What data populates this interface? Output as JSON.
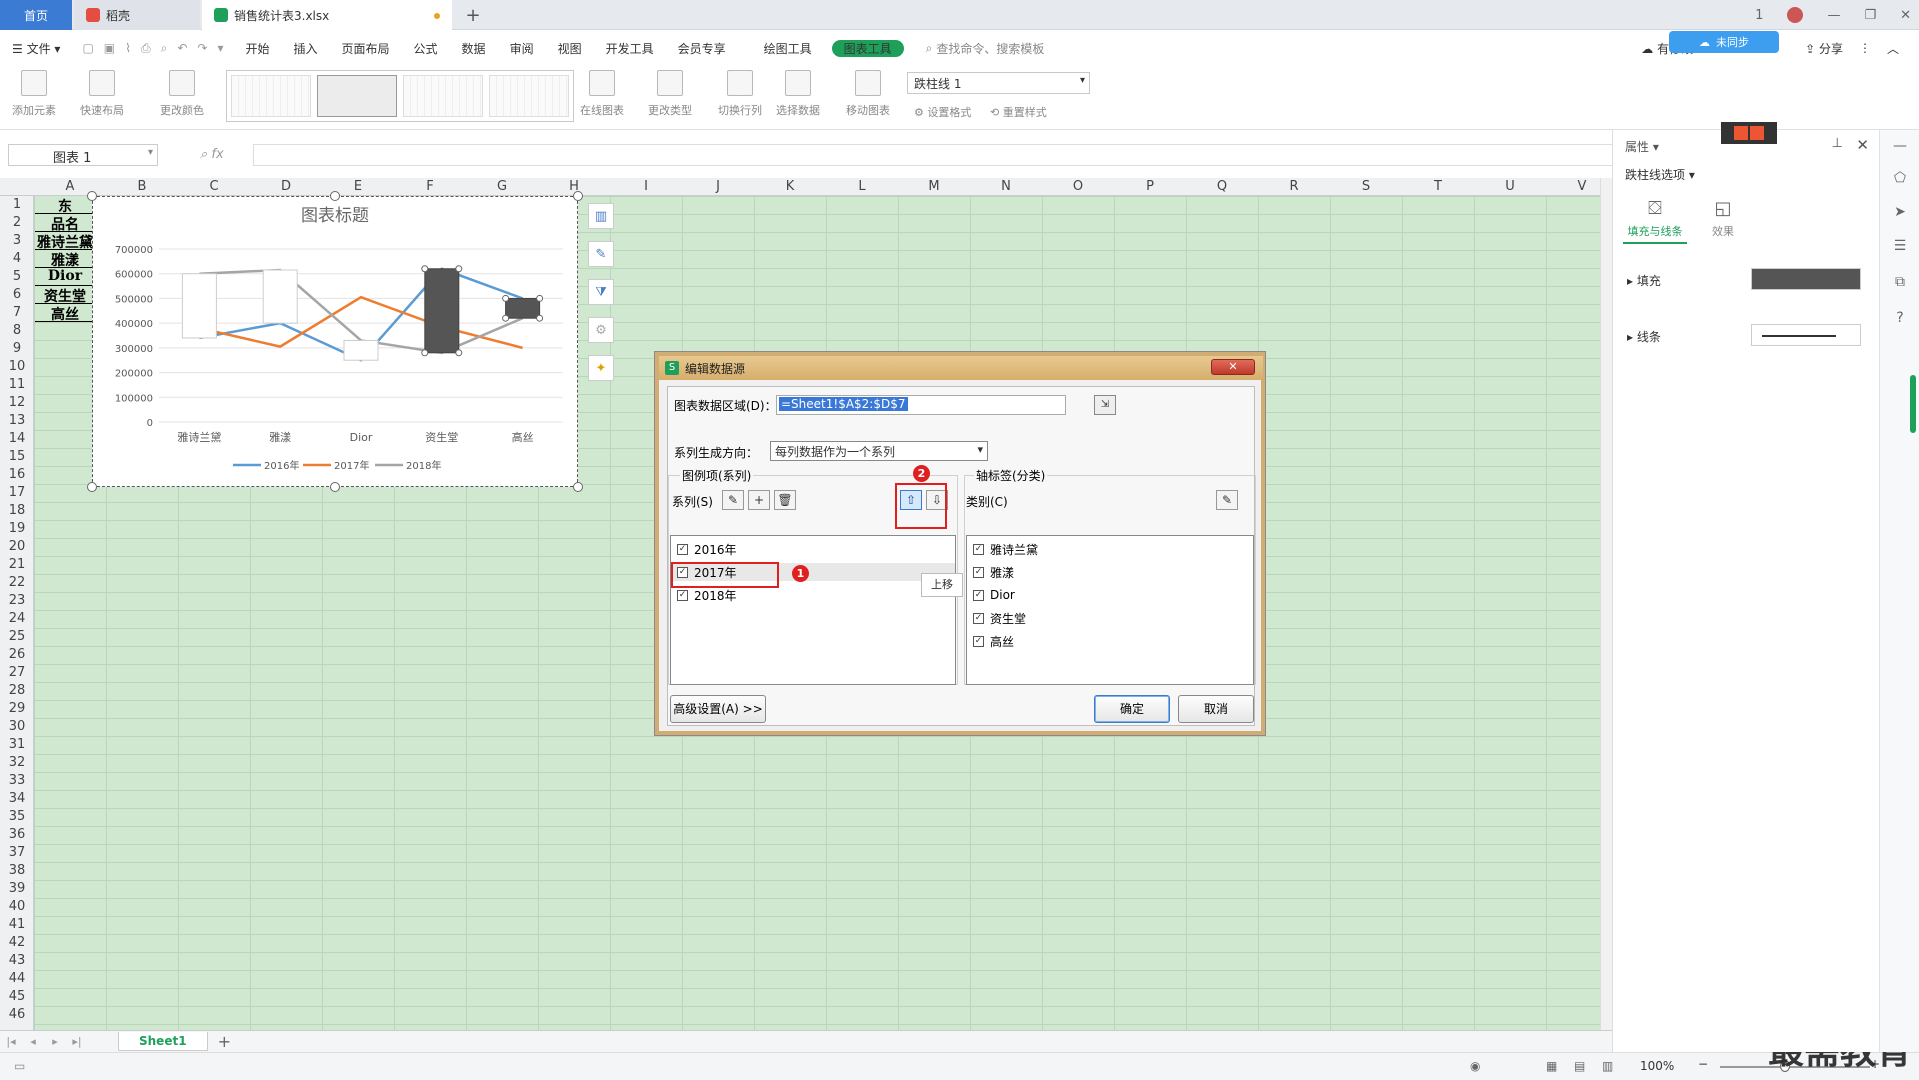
{
  "titlebar": {
    "tabs": [
      {
        "label": "首页"
      },
      {
        "label": "稻壳"
      },
      {
        "label": "销售统计表3.xlsx"
      }
    ],
    "new_tab": "+",
    "window_controls": [
      "1",
      "—",
      "❐",
      "✕"
    ]
  },
  "menu": {
    "file": "文件",
    "items": [
      "开始",
      "插入",
      "页面布局",
      "公式",
      "数据",
      "审阅",
      "视图",
      "开发工具",
      "会员专享"
    ],
    "drawing_tools": "绘图工具",
    "chart_tools": "图表工具",
    "search_placeholder": "查找命令、搜索模板",
    "right": {
      "unsynced": "有修改",
      "share": "分享"
    },
    "cloud_badge": "未同步"
  },
  "ribbon": {
    "add_element": "添加元素",
    "quick_layout": "快速布局",
    "change_color": "更改颜色",
    "online_chart": "在线图表",
    "change_type": "更改类型",
    "switch_row_col": "切换行列",
    "select_data": "选择数据",
    "move_chart": "移动图表",
    "chart_element_select": "跌柱线 1",
    "set_format": "设置格式",
    "reset_style": "重置样式"
  },
  "formula": {
    "name_box": "图表 1",
    "fx": "fx"
  },
  "sheet": {
    "columns": [
      "A",
      "B",
      "C",
      "D",
      "E",
      "F",
      "G",
      "H",
      "I",
      "J",
      "K",
      "L",
      "M",
      "N",
      "O",
      "P",
      "Q",
      "R",
      "S",
      "T",
      "U",
      "V"
    ],
    "rows": [
      "1",
      "2",
      "3",
      "4",
      "5",
      "6",
      "7",
      "8",
      "9",
      "10",
      "11",
      "12",
      "13",
      "14",
      "15",
      "16",
      "17",
      "18",
      "19",
      "20",
      "21",
      "22",
      "23",
      "24",
      "25",
      "26",
      "27",
      "28",
      "29",
      "30",
      "31",
      "32",
      "33",
      "34",
      "35",
      "36",
      "37",
      "38",
      "39",
      "40",
      "41",
      "42",
      "43",
      "44",
      "45",
      "46"
    ],
    "colA": [
      "东",
      "品名",
      "雅诗兰黛",
      "雅漾",
      "Dior",
      "资生堂",
      "高丝"
    ],
    "tab": "Sheet1",
    "add_sheet": "+"
  },
  "chart_data": {
    "type": "line",
    "title": "图表标题",
    "categories": [
      "雅诗兰黛",
      "雅漾",
      "Dior",
      "资生堂",
      "高丝"
    ],
    "series": [
      {
        "name": "2016年",
        "color": "#5b9bd5",
        "values": [
          340000,
          400000,
          250000,
          620000,
          500000
        ]
      },
      {
        "name": "2017年",
        "color": "#ed7d31",
        "values": [
          380000,
          305000,
          505000,
          385000,
          300000
        ]
      },
      {
        "name": "2018年",
        "color": "#a5a5a5",
        "values": [
          600000,
          615000,
          330000,
          280000,
          420000
        ]
      }
    ],
    "up_down_bars": [
      {
        "category": "雅诗兰黛",
        "from": 340000,
        "to": 600000,
        "kind": "up"
      },
      {
        "category": "雅漾",
        "from": 400000,
        "to": 615000,
        "kind": "up"
      },
      {
        "category": "Dior",
        "from": 250000,
        "to": 330000,
        "kind": "up"
      },
      {
        "category": "资生堂",
        "from": 620000,
        "to": 280000,
        "kind": "down"
      },
      {
        "category": "高丝",
        "from": 500000,
        "to": 420000,
        "kind": "down"
      }
    ],
    "yticks": [
      "0",
      "100000",
      "200000",
      "300000",
      "400000",
      "500000",
      "600000",
      "700000"
    ],
    "ylim": [
      0,
      700000
    ],
    "legend": "bottom",
    "grid": true
  },
  "right_panel": {
    "title": "属性",
    "option_select": "跌柱线选项",
    "tab_fill": "填充与线条",
    "tab_effect": "效果",
    "fill": "填充",
    "line": "线条",
    "fill_color": "#555555"
  },
  "dialog": {
    "title": "编辑数据源",
    "close": "✕",
    "range_label": "图表数据区域(D)：",
    "range_value": "=Sheet1!$A$2:$D$7",
    "direction_label": "系列生成方向：",
    "direction_value": "每列数据作为一个系列",
    "legend_group": "图例项(系列)",
    "series_label": "系列(S)",
    "axis_group": "轴标签(分类)",
    "category_label": "类别(C)",
    "series_items": [
      "2016年",
      "2017年",
      "2018年"
    ],
    "category_items": [
      "雅诗兰黛",
      "雅漾",
      "Dior",
      "资生堂",
      "高丝"
    ],
    "tooltip": "上移",
    "advanced": "高级设置(A) >>",
    "ok": "确定",
    "cancel": "取消",
    "marker1": "1",
    "marker2": "2"
  },
  "status": {
    "zoom": "100%",
    "watermark": "最需教育"
  }
}
